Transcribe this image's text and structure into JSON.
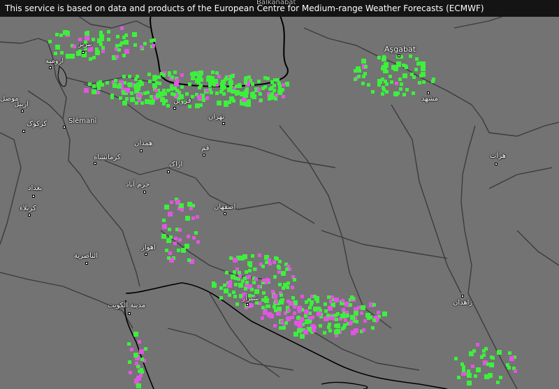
{
  "attribution": "This service is based on data and products of the European Centre for Medium-range Weather Forecasts (ECMWF)",
  "colors": {
    "land": "#737373",
    "banner_bg": "#141414",
    "border_line": "#3c3c3c",
    "coast_line": "#000000",
    "sea": "#777777",
    "precip_green": "#3cf03c",
    "precip_magenta": "#e056e0"
  },
  "cities": [
    {
      "id": "tabriz",
      "label": "تبریز"
    },
    {
      "id": "urmia",
      "label": "ارومیه"
    },
    {
      "id": "mosul",
      "label": "موصل"
    },
    {
      "id": "erbil",
      "label": "اربیل"
    },
    {
      "id": "kirkuk",
      "label": "کرکوک"
    },
    {
      "id": "sulaymaniyah",
      "label": "Slêmanî"
    },
    {
      "id": "qazvin",
      "label": "قزوین"
    },
    {
      "id": "tehran",
      "label": "تهران"
    },
    {
      "id": "hamadan",
      "label": "همدان"
    },
    {
      "id": "kermanshah",
      "label": "کرمانشاه"
    },
    {
      "id": "qom",
      "label": "قم"
    },
    {
      "id": "arak",
      "label": "اراک"
    },
    {
      "id": "baghdad",
      "label": "بغداد"
    },
    {
      "id": "khorramabad",
      "label": "خرم آباد"
    },
    {
      "id": "karbala",
      "label": "كربلاء"
    },
    {
      "id": "isfahan",
      "label": "اصفهان"
    },
    {
      "id": "ahvaz",
      "label": "اهواز"
    },
    {
      "id": "nasiriyah",
      "label": "الناصرية"
    },
    {
      "id": "kuwait-city",
      "label": "مدينة الكويت"
    },
    {
      "id": "shiraz",
      "label": "شیراز"
    },
    {
      "id": "zahedan",
      "label": "زاهدان"
    },
    {
      "id": "ashgabat",
      "label": "Aşgabat"
    },
    {
      "id": "mashhad",
      "label": "مشهد"
    },
    {
      "id": "herat",
      "label": "هرات"
    },
    {
      "id": "balkanabat",
      "label": "Balkanabat"
    }
  ]
}
